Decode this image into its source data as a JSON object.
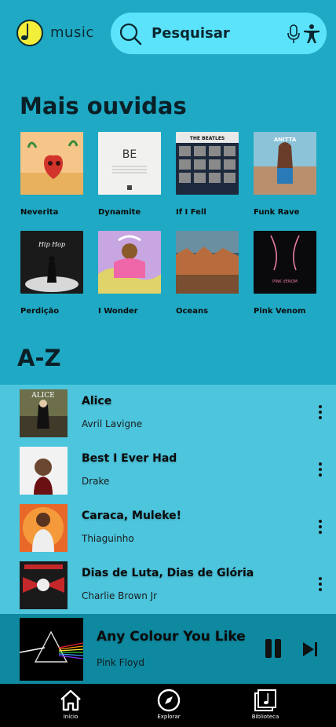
{
  "app": {
    "name": "music"
  },
  "search": {
    "placeholder": "Pesquisar"
  },
  "most_played": {
    "title": "Mais ouvidas",
    "items": [
      {
        "label": "Neverita"
      },
      {
        "label": "Dynamite",
        "cover_text": "BE"
      },
      {
        "label": "If I Fell",
        "cover_text": "THE BEATLES"
      },
      {
        "label": "Funk Rave",
        "cover_text": "ANITTA"
      },
      {
        "label": "Perdição",
        "cover_text": "Hip Hop"
      },
      {
        "label": "I Wonder"
      },
      {
        "label": "Oceans"
      },
      {
        "label": "Pink Venom",
        "cover_text": "PINK VENOM"
      }
    ]
  },
  "az": {
    "title": "A-Z",
    "rows": [
      {
        "title": "Alice",
        "artist": "Avril Lavigne",
        "cover_text": "ALICE"
      },
      {
        "title": "Best I Ever Had",
        "artist": "Drake"
      },
      {
        "title": "Caraca, Muleke!",
        "artist": "Thiaguinho"
      },
      {
        "title": "Dias de Luta, Dias de Glória",
        "artist": "Charlie Brown Jr"
      }
    ]
  },
  "now_playing": {
    "title": "Any Colour You Like",
    "artist": "Pink Floyd"
  },
  "nav": {
    "home": "Início",
    "explore": "Explorar",
    "library": "Biblioteca"
  },
  "colors": {
    "background": "#1fa9c4",
    "search": "#5ae3fb",
    "list_bg": "#4cc5dd",
    "player_bg": "#0e89a0",
    "nav_bg": "#000000"
  }
}
